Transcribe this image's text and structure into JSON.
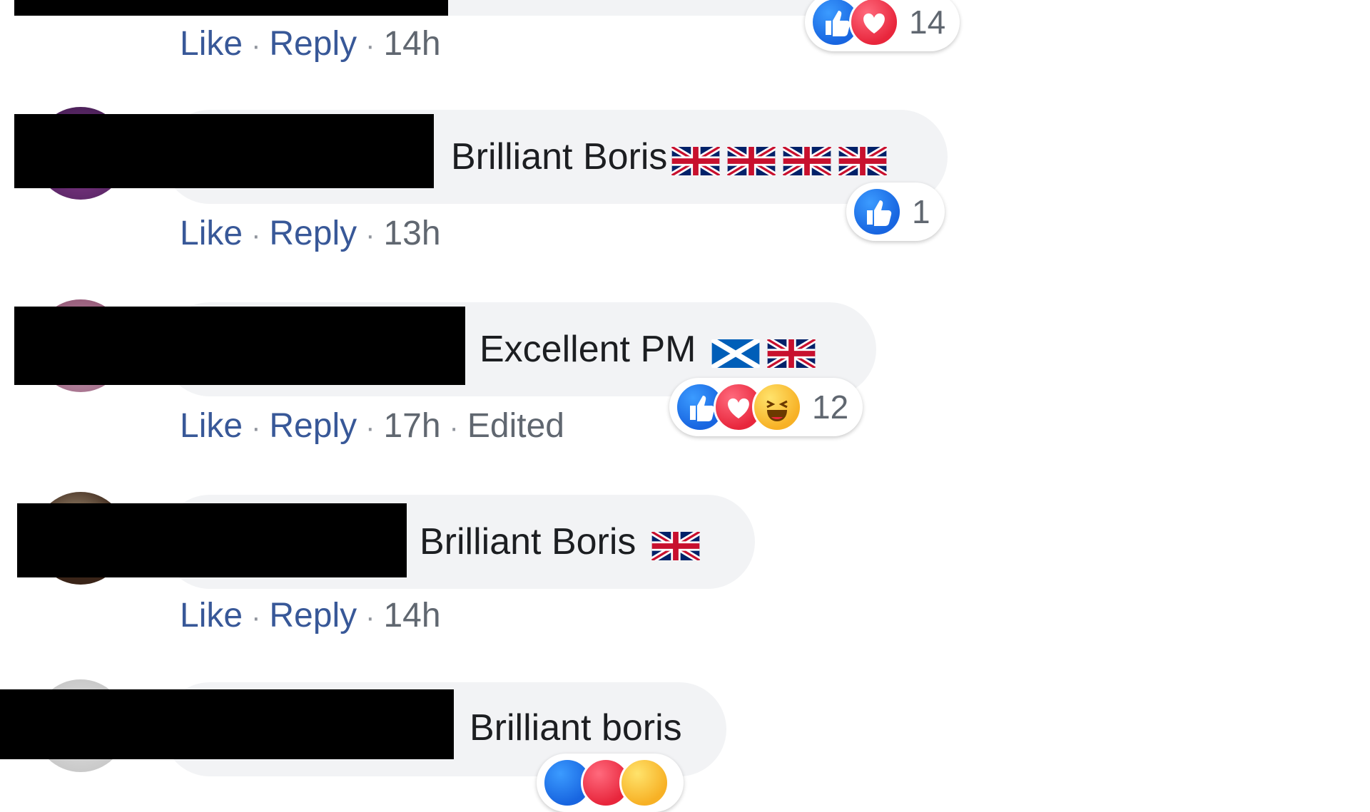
{
  "actions": {
    "like": "Like",
    "reply": "Reply",
    "sep": "·",
    "edited": "Edited"
  },
  "comments": [
    {
      "text": "",
      "time": "14h",
      "reaction_types": [
        "like",
        "love"
      ],
      "reaction_count": "14"
    },
    {
      "text": "Brilliant Boris",
      "flags": [
        "union-jack",
        "union-jack",
        "union-jack",
        "union-jack"
      ],
      "time": "13h",
      "reaction_types": [
        "like"
      ],
      "reaction_count": "1"
    },
    {
      "text": "Excellent PM",
      "flags": [
        "saltire",
        "union-jack"
      ],
      "time": "17h",
      "edited": true,
      "reaction_types": [
        "like",
        "love",
        "haha"
      ],
      "reaction_count": "12"
    },
    {
      "text": "Brilliant Boris",
      "flags": [
        "union-jack"
      ],
      "time": "14h"
    },
    {
      "text": "Brilliant boris",
      "reaction_types": [
        "like",
        "love",
        "haha"
      ]
    }
  ],
  "colors": {
    "bubble": "#f2f3f5",
    "link": "#385898",
    "meta": "#606770",
    "like": "#1877f2",
    "love": "#f33e58",
    "haha": "#f7b125"
  }
}
